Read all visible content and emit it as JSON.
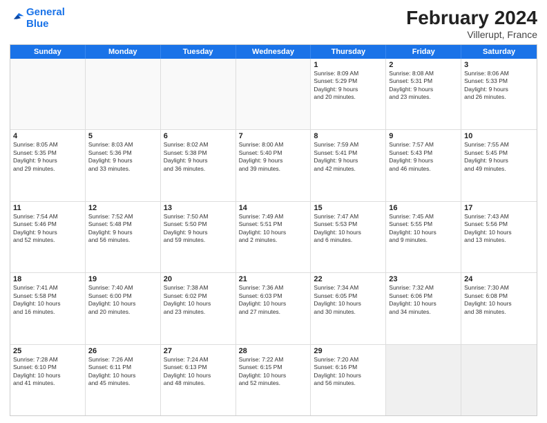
{
  "logo": {
    "line1": "General",
    "line2": "Blue"
  },
  "title": "February 2024",
  "subtitle": "Villerupt, France",
  "days": [
    "Sunday",
    "Monday",
    "Tuesday",
    "Wednesday",
    "Thursday",
    "Friday",
    "Saturday"
  ],
  "rows": [
    [
      {
        "day": "",
        "lines": [],
        "empty": true
      },
      {
        "day": "",
        "lines": [],
        "empty": true
      },
      {
        "day": "",
        "lines": [],
        "empty": true
      },
      {
        "day": "",
        "lines": [],
        "empty": true
      },
      {
        "day": "1",
        "lines": [
          "Sunrise: 8:09 AM",
          "Sunset: 5:29 PM",
          "Daylight: 9 hours",
          "and 20 minutes."
        ]
      },
      {
        "day": "2",
        "lines": [
          "Sunrise: 8:08 AM",
          "Sunset: 5:31 PM",
          "Daylight: 9 hours",
          "and 23 minutes."
        ]
      },
      {
        "day": "3",
        "lines": [
          "Sunrise: 8:06 AM",
          "Sunset: 5:33 PM",
          "Daylight: 9 hours",
          "and 26 minutes."
        ]
      }
    ],
    [
      {
        "day": "4",
        "lines": [
          "Sunrise: 8:05 AM",
          "Sunset: 5:35 PM",
          "Daylight: 9 hours",
          "and 29 minutes."
        ]
      },
      {
        "day": "5",
        "lines": [
          "Sunrise: 8:03 AM",
          "Sunset: 5:36 PM",
          "Daylight: 9 hours",
          "and 33 minutes."
        ]
      },
      {
        "day": "6",
        "lines": [
          "Sunrise: 8:02 AM",
          "Sunset: 5:38 PM",
          "Daylight: 9 hours",
          "and 36 minutes."
        ]
      },
      {
        "day": "7",
        "lines": [
          "Sunrise: 8:00 AM",
          "Sunset: 5:40 PM",
          "Daylight: 9 hours",
          "and 39 minutes."
        ]
      },
      {
        "day": "8",
        "lines": [
          "Sunrise: 7:59 AM",
          "Sunset: 5:41 PM",
          "Daylight: 9 hours",
          "and 42 minutes."
        ]
      },
      {
        "day": "9",
        "lines": [
          "Sunrise: 7:57 AM",
          "Sunset: 5:43 PM",
          "Daylight: 9 hours",
          "and 46 minutes."
        ]
      },
      {
        "day": "10",
        "lines": [
          "Sunrise: 7:55 AM",
          "Sunset: 5:45 PM",
          "Daylight: 9 hours",
          "and 49 minutes."
        ]
      }
    ],
    [
      {
        "day": "11",
        "lines": [
          "Sunrise: 7:54 AM",
          "Sunset: 5:46 PM",
          "Daylight: 9 hours",
          "and 52 minutes."
        ]
      },
      {
        "day": "12",
        "lines": [
          "Sunrise: 7:52 AM",
          "Sunset: 5:48 PM",
          "Daylight: 9 hours",
          "and 56 minutes."
        ]
      },
      {
        "day": "13",
        "lines": [
          "Sunrise: 7:50 AM",
          "Sunset: 5:50 PM",
          "Daylight: 9 hours",
          "and 59 minutes."
        ]
      },
      {
        "day": "14",
        "lines": [
          "Sunrise: 7:49 AM",
          "Sunset: 5:51 PM",
          "Daylight: 10 hours",
          "and 2 minutes."
        ]
      },
      {
        "day": "15",
        "lines": [
          "Sunrise: 7:47 AM",
          "Sunset: 5:53 PM",
          "Daylight: 10 hours",
          "and 6 minutes."
        ]
      },
      {
        "day": "16",
        "lines": [
          "Sunrise: 7:45 AM",
          "Sunset: 5:55 PM",
          "Daylight: 10 hours",
          "and 9 minutes."
        ]
      },
      {
        "day": "17",
        "lines": [
          "Sunrise: 7:43 AM",
          "Sunset: 5:56 PM",
          "Daylight: 10 hours",
          "and 13 minutes."
        ]
      }
    ],
    [
      {
        "day": "18",
        "lines": [
          "Sunrise: 7:41 AM",
          "Sunset: 5:58 PM",
          "Daylight: 10 hours",
          "and 16 minutes."
        ]
      },
      {
        "day": "19",
        "lines": [
          "Sunrise: 7:40 AM",
          "Sunset: 6:00 PM",
          "Daylight: 10 hours",
          "and 20 minutes."
        ]
      },
      {
        "day": "20",
        "lines": [
          "Sunrise: 7:38 AM",
          "Sunset: 6:02 PM",
          "Daylight: 10 hours",
          "and 23 minutes."
        ]
      },
      {
        "day": "21",
        "lines": [
          "Sunrise: 7:36 AM",
          "Sunset: 6:03 PM",
          "Daylight: 10 hours",
          "and 27 minutes."
        ]
      },
      {
        "day": "22",
        "lines": [
          "Sunrise: 7:34 AM",
          "Sunset: 6:05 PM",
          "Daylight: 10 hours",
          "and 30 minutes."
        ]
      },
      {
        "day": "23",
        "lines": [
          "Sunrise: 7:32 AM",
          "Sunset: 6:06 PM",
          "Daylight: 10 hours",
          "and 34 minutes."
        ]
      },
      {
        "day": "24",
        "lines": [
          "Sunrise: 7:30 AM",
          "Sunset: 6:08 PM",
          "Daylight: 10 hours",
          "and 38 minutes."
        ]
      }
    ],
    [
      {
        "day": "25",
        "lines": [
          "Sunrise: 7:28 AM",
          "Sunset: 6:10 PM",
          "Daylight: 10 hours",
          "and 41 minutes."
        ]
      },
      {
        "day": "26",
        "lines": [
          "Sunrise: 7:26 AM",
          "Sunset: 6:11 PM",
          "Daylight: 10 hours",
          "and 45 minutes."
        ]
      },
      {
        "day": "27",
        "lines": [
          "Sunrise: 7:24 AM",
          "Sunset: 6:13 PM",
          "Daylight: 10 hours",
          "and 48 minutes."
        ]
      },
      {
        "day": "28",
        "lines": [
          "Sunrise: 7:22 AM",
          "Sunset: 6:15 PM",
          "Daylight: 10 hours",
          "and 52 minutes."
        ]
      },
      {
        "day": "29",
        "lines": [
          "Sunrise: 7:20 AM",
          "Sunset: 6:16 PM",
          "Daylight: 10 hours",
          "and 56 minutes."
        ]
      },
      {
        "day": "",
        "lines": [],
        "empty": true,
        "shaded": true
      },
      {
        "day": "",
        "lines": [],
        "empty": true,
        "shaded": true
      }
    ]
  ]
}
